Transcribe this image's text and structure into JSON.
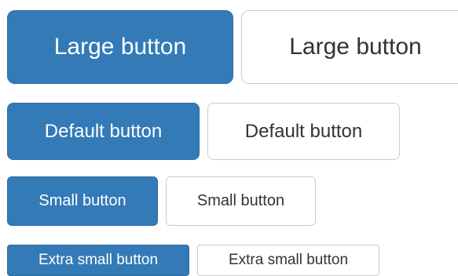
{
  "rows": {
    "large": {
      "primary_label": "Large button",
      "default_label": "Large button"
    },
    "default": {
      "primary_label": "Default button",
      "default_label": "Default button"
    },
    "small": {
      "primary_label": "Small button",
      "default_label": "Small button"
    },
    "extra_small": {
      "primary_label": "Extra small button",
      "default_label": "Extra small button"
    }
  },
  "colors": {
    "primary_bg": "#337ab7",
    "primary_border": "#2e6da4",
    "primary_text": "#ffffff",
    "default_bg": "#ffffff",
    "default_border": "#cccccc",
    "default_text": "#333333"
  }
}
